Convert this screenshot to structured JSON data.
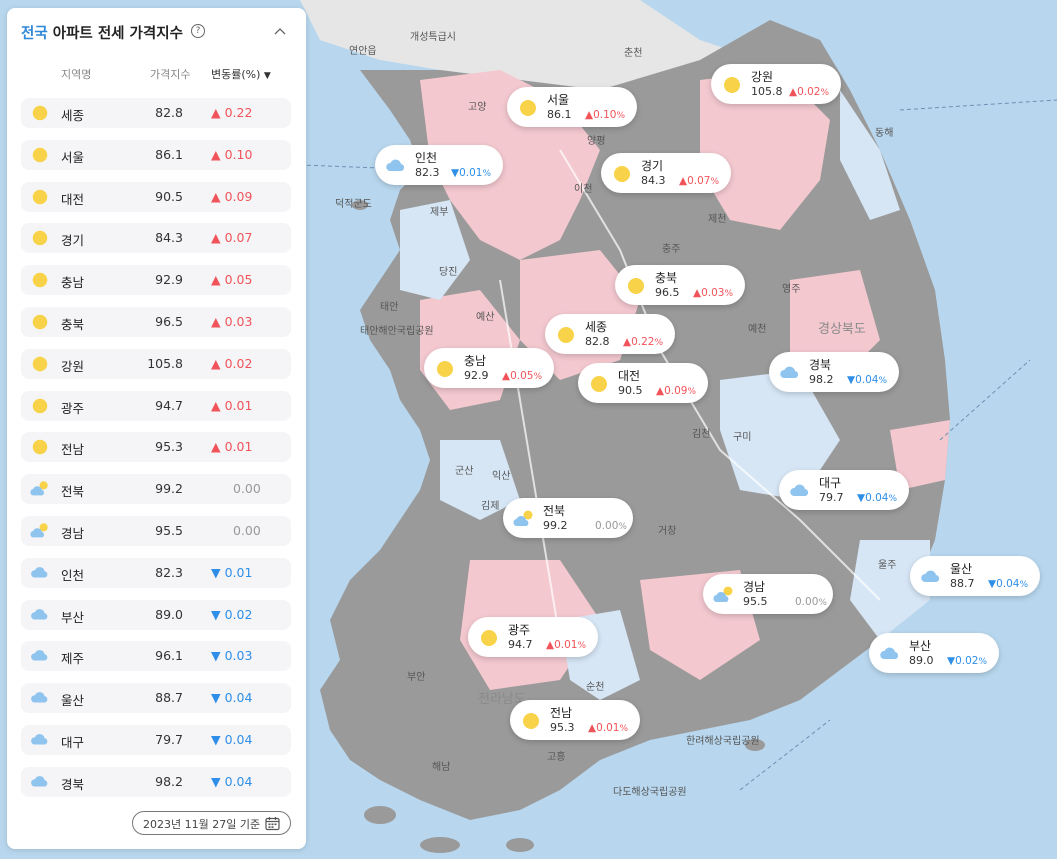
{
  "panel": {
    "title_accent": "전국",
    "title": "아파트 전세 가격지수",
    "help_icon": "question-circle-icon",
    "collapse_icon": "chevron-up-icon",
    "columns": {
      "region": "지역명",
      "index": "가격지수",
      "change": "변동률(%)",
      "sort_icon": "caret-down-icon"
    },
    "rows": [
      {
        "weather": "sunny",
        "name": "세종",
        "index": "82.8",
        "dir": "up",
        "change": "0.22"
      },
      {
        "weather": "sunny",
        "name": "서울",
        "index": "86.1",
        "dir": "up",
        "change": "0.10"
      },
      {
        "weather": "sunny",
        "name": "대전",
        "index": "90.5",
        "dir": "up",
        "change": "0.09"
      },
      {
        "weather": "sunny",
        "name": "경기",
        "index": "84.3",
        "dir": "up",
        "change": "0.07"
      },
      {
        "weather": "sunny",
        "name": "충남",
        "index": "92.9",
        "dir": "up",
        "change": "0.05"
      },
      {
        "weather": "sunny",
        "name": "충북",
        "index": "96.5",
        "dir": "up",
        "change": "0.03"
      },
      {
        "weather": "sunny",
        "name": "강원",
        "index": "105.8",
        "dir": "up",
        "change": "0.02"
      },
      {
        "weather": "sunny",
        "name": "광주",
        "index": "94.7",
        "dir": "up",
        "change": "0.01"
      },
      {
        "weather": "sunny",
        "name": "전남",
        "index": "95.3",
        "dir": "up",
        "change": "0.01"
      },
      {
        "weather": "partly-cloudy",
        "name": "전북",
        "index": "99.2",
        "dir": "flat",
        "change": "0.00"
      },
      {
        "weather": "partly-cloudy",
        "name": "경남",
        "index": "95.5",
        "dir": "flat",
        "change": "0.00"
      },
      {
        "weather": "cloudy",
        "name": "인천",
        "index": "82.3",
        "dir": "down",
        "change": "0.01"
      },
      {
        "weather": "cloudy",
        "name": "부산",
        "index": "89.0",
        "dir": "down",
        "change": "0.02"
      },
      {
        "weather": "cloudy",
        "name": "제주",
        "index": "96.1",
        "dir": "down",
        "change": "0.03"
      },
      {
        "weather": "cloudy",
        "name": "울산",
        "index": "88.7",
        "dir": "down",
        "change": "0.04"
      },
      {
        "weather": "cloudy",
        "name": "대구",
        "index": "79.7",
        "dir": "down",
        "change": "0.04"
      },
      {
        "weather": "cloudy",
        "name": "경북",
        "index": "98.2",
        "dir": "down",
        "change": "0.04"
      }
    ],
    "date_label": "2023년 11월 27일 기준",
    "calendar_icon": "calendar-icon"
  },
  "map": {
    "pct_sign": "%",
    "bubbles": [
      {
        "name": "강원",
        "weather": "sunny",
        "index": "105.8",
        "dir": "up",
        "change": "0.02"
      },
      {
        "name": "서울",
        "weather": "sunny",
        "index": "86.1",
        "dir": "up",
        "change": "0.10"
      },
      {
        "name": "인천",
        "weather": "cloudy",
        "index": "82.3",
        "dir": "down",
        "change": "0.01"
      },
      {
        "name": "경기",
        "weather": "sunny",
        "index": "84.3",
        "dir": "up",
        "change": "0.07"
      },
      {
        "name": "충북",
        "weather": "sunny",
        "index": "96.5",
        "dir": "up",
        "change": "0.03"
      },
      {
        "name": "세종",
        "weather": "sunny",
        "index": "82.8",
        "dir": "up",
        "change": "0.22"
      },
      {
        "name": "충남",
        "weather": "sunny",
        "index": "92.9",
        "dir": "up",
        "change": "0.05"
      },
      {
        "name": "대전",
        "weather": "sunny",
        "index": "90.5",
        "dir": "up",
        "change": "0.09"
      },
      {
        "name": "경북",
        "weather": "cloudy",
        "index": "98.2",
        "dir": "down",
        "change": "0.04"
      },
      {
        "name": "대구",
        "weather": "cloudy",
        "index": "79.7",
        "dir": "down",
        "change": "0.04"
      },
      {
        "name": "전북",
        "weather": "partly-cloudy",
        "index": "99.2",
        "dir": "flat",
        "change": "0.00"
      },
      {
        "name": "울산",
        "weather": "cloudy",
        "index": "88.7",
        "dir": "down",
        "change": "0.04"
      },
      {
        "name": "경남",
        "weather": "partly-cloudy",
        "index": "95.5",
        "dir": "flat",
        "change": "0.00"
      },
      {
        "name": "광주",
        "weather": "sunny",
        "index": "94.7",
        "dir": "up",
        "change": "0.01"
      },
      {
        "name": "부산",
        "weather": "cloudy",
        "index": "89.0",
        "dir": "down",
        "change": "0.02"
      },
      {
        "name": "전남",
        "weather": "sunny",
        "index": "95.3",
        "dir": "up",
        "change": "0.01"
      }
    ],
    "places": [
      "개성특급시",
      "연안읍",
      "춘천",
      "고양",
      "양평",
      "이천",
      "제천",
      "충주",
      "영주",
      "당진",
      "예산",
      "태안",
      "태안해안국립공원",
      "덕적군도",
      "제부",
      "예천",
      "김천",
      "구미",
      "군산",
      "익산",
      "김제",
      "거창",
      "순천",
      "해남",
      "고흥",
      "부안",
      "경상북도",
      "전라남도",
      "한려해상국립공원",
      "다도해상국립공원",
      "울주",
      "동해"
    ],
    "colors": {
      "sea": "#b8d7ee",
      "grey": "#9a9a9a",
      "pink": "#f3c8cf",
      "lightblue": "#d6e6f5",
      "up": "#f0545a",
      "down": "#2f8fe8"
    }
  }
}
